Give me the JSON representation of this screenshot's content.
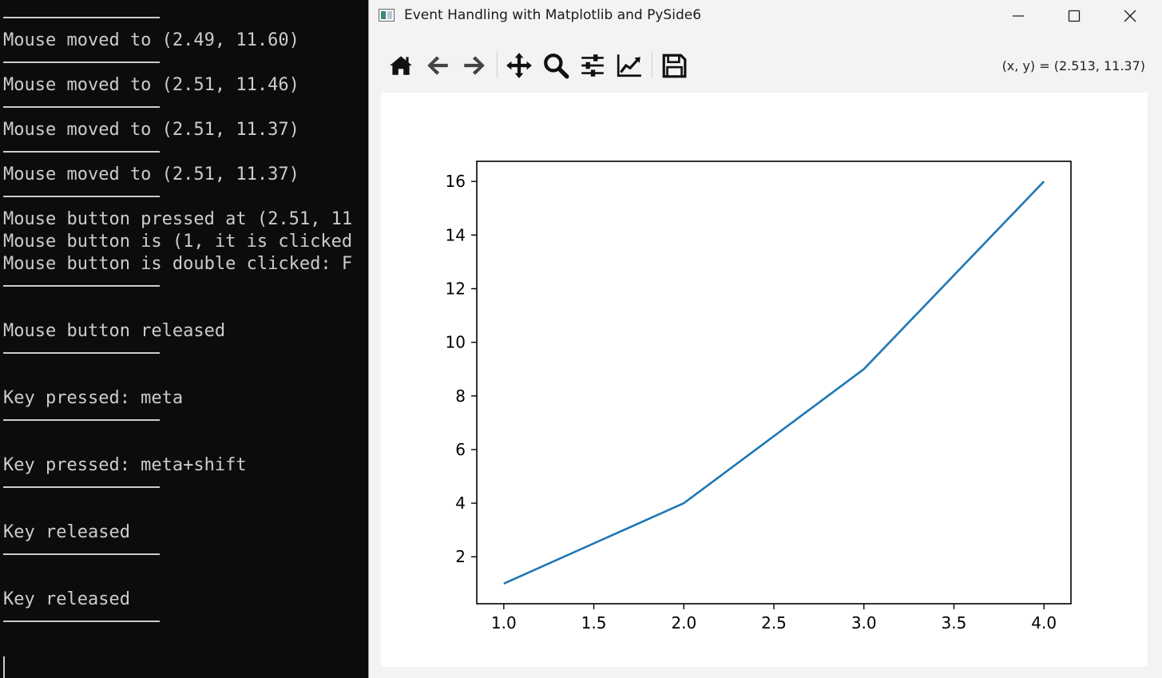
{
  "terminal": {
    "lines": [
      "Mouse moved to (2.49, 11.60)",
      "Mouse moved to (2.51, 11.46)",
      "Mouse moved to (2.51, 11.37)",
      "Mouse moved to (2.51, 11.37)",
      "Mouse button pressed at (2.51, 11",
      "Mouse button is (1, it is clicked",
      "Mouse button is double clicked: F",
      "Mouse button released",
      "Key pressed: meta",
      "Key pressed: meta+shift",
      "Key released",
      "Key released"
    ]
  },
  "window": {
    "title": "Event Handling with Matplotlib and PySide6",
    "controls": {
      "minimize": "minimize-icon",
      "maximize": "maximize-icon",
      "close": "close-icon"
    }
  },
  "toolbar": {
    "buttons": [
      "home-icon",
      "back-arrow-icon",
      "forward-arrow-icon",
      "pan-icon",
      "zoom-icon",
      "subplots-icon",
      "customize-icon",
      "save-icon"
    ],
    "coords": "(x, y) = (2.513, 11.37)"
  },
  "chart_data": {
    "type": "line",
    "x": [
      1.0,
      2.0,
      3.0,
      4.0
    ],
    "series": [
      {
        "values": [
          1,
          4,
          9,
          16
        ],
        "color": "#1f77b4"
      }
    ],
    "xlim": [
      0.85,
      4.15
    ],
    "ylim": [
      0.25,
      16.75
    ],
    "xticks": [
      "1.0",
      "1.5",
      "2.0",
      "2.5",
      "3.0",
      "3.5",
      "4.0"
    ],
    "yticks": [
      "2",
      "4",
      "6",
      "8",
      "10",
      "12",
      "14",
      "16"
    ],
    "grid": false
  }
}
